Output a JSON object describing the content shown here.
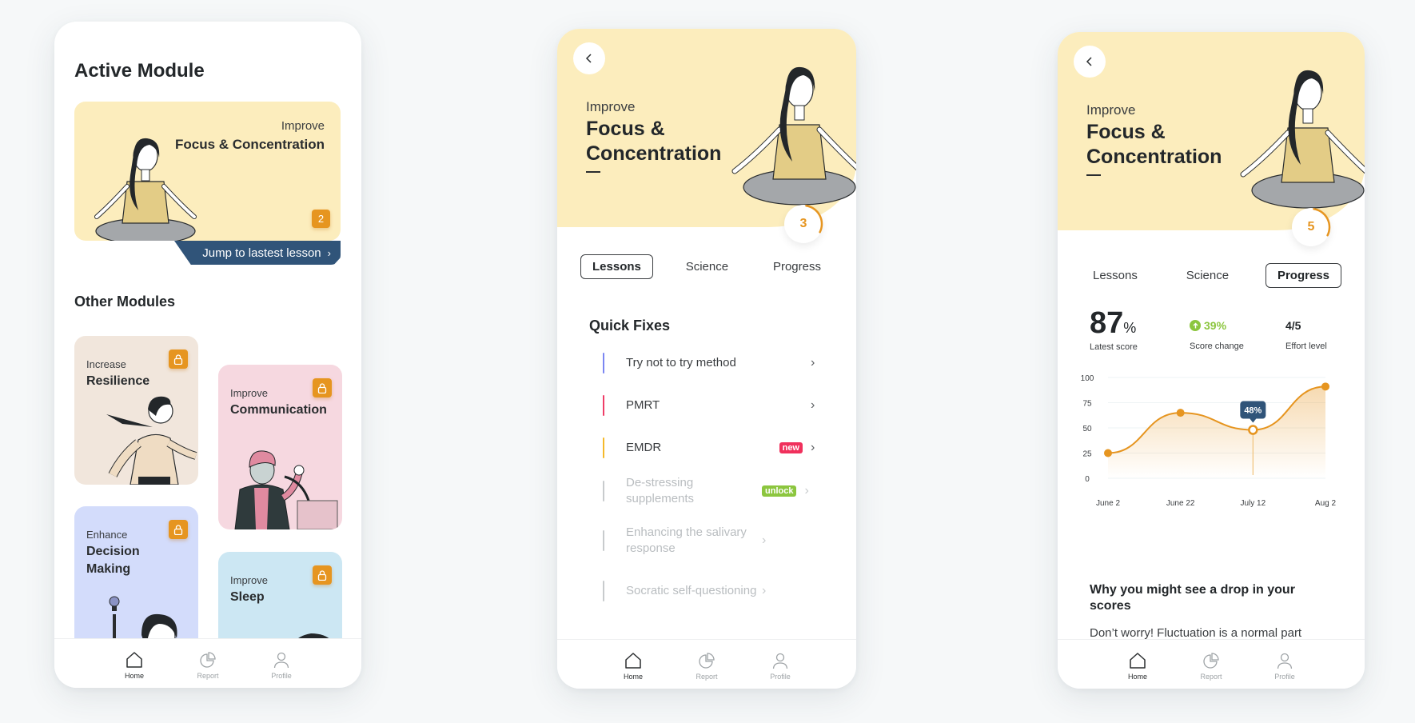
{
  "colors": {
    "accent_orange": "#e69520",
    "hero_yellow": "#fcedbd",
    "banner_navy": "#305479",
    "new_badge": "#f0305c",
    "unlock_badge": "#8cc63f",
    "score_up_green": "#8cc63f"
  },
  "nav": [
    {
      "label": "Home",
      "icon": "home-icon",
      "active": true
    },
    {
      "label": "Report",
      "icon": "report-pie-icon",
      "active": false
    },
    {
      "label": "Profile",
      "icon": "profile-icon",
      "active": false
    }
  ],
  "home": {
    "title": "Active Module",
    "active_module": {
      "kicker": "Improve",
      "title": "Focus & Concentration",
      "count": "2",
      "jump_label": "Jump to lastest lesson",
      "jump_icon": "chevron-right-icon"
    },
    "other_title": "Other Modules",
    "modules": [
      {
        "kicker": "Increase",
        "name": "Resilience",
        "locked": true
      },
      {
        "kicker": "Improve",
        "name": "Communication",
        "locked": true
      },
      {
        "kicker": "Enhance",
        "name": "Decision Making",
        "locked": true
      },
      {
        "kicker": "Improve",
        "name": "Sleep",
        "locked": true
      }
    ]
  },
  "module_header": {
    "back_icon": "chevron-left-icon",
    "kicker": "Improve",
    "title": "Focus & Concentration"
  },
  "lessons_screen": {
    "ring_value": "3",
    "ring_progress": 0.3,
    "tabs": [
      "Lessons",
      "Science",
      "Progress"
    ],
    "active_tab": 0,
    "section": "Quick Fixes",
    "lessons": [
      {
        "name": "Try not to try method",
        "bar": "#7b86f2",
        "tag": null,
        "locked": false
      },
      {
        "name": "PMRT",
        "bar": "#ef3d67",
        "tag": null,
        "locked": false
      },
      {
        "name": "EMDR",
        "bar": "#f5b92a",
        "tag": "new",
        "locked": false
      },
      {
        "name": "De-stressing supplements",
        "bar": "#c8cbcd",
        "tag": "unlock",
        "locked": true
      },
      {
        "name": "Enhancing the salivary response",
        "bar": "#c8cbcd",
        "tag": null,
        "locked": true
      },
      {
        "name": "Socratic self-questioning",
        "bar": "#c8cbcd",
        "tag": null,
        "locked": true
      }
    ]
  },
  "progress_screen": {
    "ring_value": "5",
    "ring_progress": 0.3,
    "tabs": [
      "Lessons",
      "Science",
      "Progress"
    ],
    "active_tab": 2,
    "latest_score": "87",
    "latest_score_unit": "%",
    "latest_score_label": "Latest score",
    "score_change": "39%",
    "score_change_label": "Score change",
    "effort": "4/5",
    "effort_label": "Effort level",
    "why_title": "Why you might see a drop in your scores",
    "why_text": "Don’t worry! Fluctuation is a normal part"
  },
  "chart_data": {
    "type": "area",
    "title": "",
    "xlabel": "",
    "ylabel": "",
    "categories": [
      "June 2",
      "June 22",
      "July 12",
      "Aug 2"
    ],
    "values": [
      25,
      65,
      48,
      91
    ],
    "ylim": [
      0,
      100
    ],
    "yticks": [
      0,
      25,
      50,
      75,
      100
    ],
    "grid": true,
    "highlight": {
      "index": 2,
      "label": "48%"
    },
    "series_color": "#e69520",
    "tooltip_color": "#305479"
  }
}
